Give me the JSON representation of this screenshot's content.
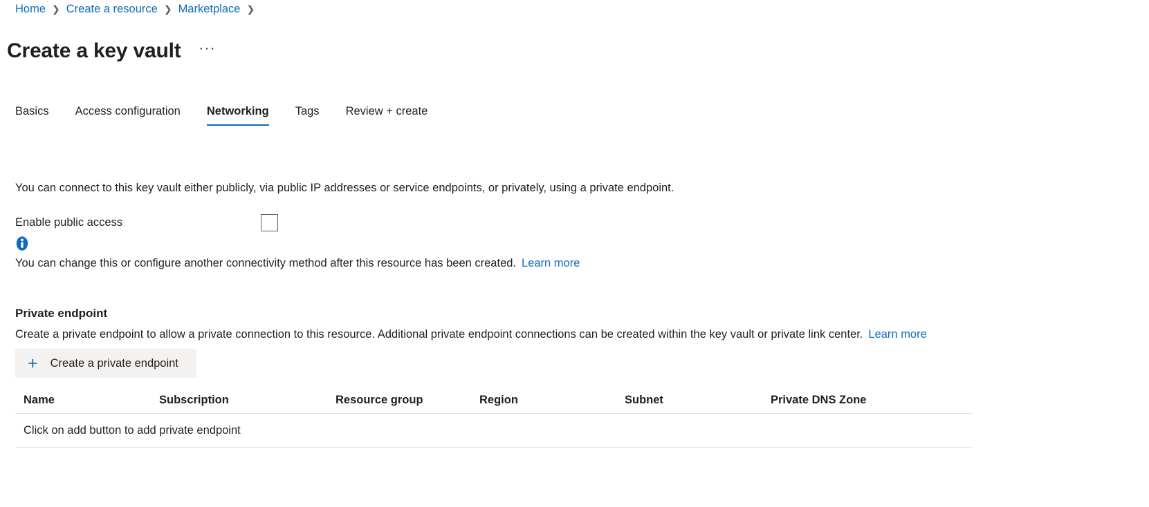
{
  "breadcrumb": {
    "separator": "❯",
    "items": [
      {
        "label": "Home"
      },
      {
        "label": "Create a resource"
      },
      {
        "label": "Marketplace"
      }
    ]
  },
  "header": {
    "title": "Create a key vault",
    "more_label": "···"
  },
  "tabs": [
    {
      "label": "Basics",
      "active": false
    },
    {
      "label": "Access configuration",
      "active": false
    },
    {
      "label": "Networking",
      "active": true
    },
    {
      "label": "Tags",
      "active": false
    },
    {
      "label": "Review + create",
      "active": false
    }
  ],
  "networking": {
    "intro": "You can connect to this key vault either publicly, via public IP addresses or service endpoints, or privately, using a private endpoint.",
    "public_access": {
      "label": "Enable public access",
      "checked": false
    },
    "info": {
      "icon": "info-icon",
      "message": "You can change this or configure another connectivity method after this resource has been created.",
      "link_label": "Learn more"
    },
    "private_endpoint": {
      "heading": "Private endpoint",
      "description": "Create a private endpoint to allow a private connection to this resource. Additional private endpoint connections can be created within the key vault or private link center.",
      "link_label": "Learn more",
      "create_button": {
        "icon": "plus-icon",
        "label": "Create a private endpoint"
      },
      "table": {
        "columns": [
          "Name",
          "Subscription",
          "Resource group",
          "Region",
          "Subnet",
          "Private DNS Zone"
        ],
        "empty_message": "Click on add button to add private endpoint",
        "rows": []
      }
    }
  },
  "colors": {
    "link": "#0f6cbd",
    "accent": "#0f6cbd",
    "text": "#201f1e",
    "button_bg": "#f3f2f1",
    "rule": "#e1dfdd"
  }
}
